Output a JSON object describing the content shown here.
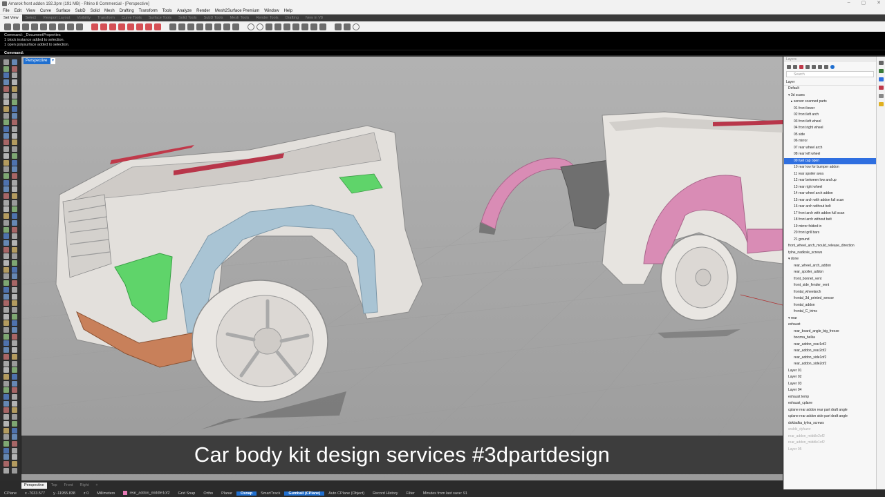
{
  "window": {
    "title": "Amarok front addon 192.3pm (191 MB) - Rhino 8 Commercial - [Perspective]"
  },
  "menu": {
    "items": [
      "File",
      "Edit",
      "View",
      "Curve",
      "Surface",
      "SubD",
      "Solid",
      "Mesh",
      "Drafting",
      "Transform",
      "Tools",
      "Analyze",
      "Render",
      "Mesh2Surface Premium",
      "Window",
      "Help"
    ]
  },
  "toolbar_tabs": {
    "items": [
      "Set View",
      "Select",
      "Viewport Layout",
      "Visibility",
      "Transform",
      "Curve Tools",
      "Surface Tools",
      "Solid Tools",
      "SubD Tools",
      "Mesh Tools",
      "Render Tools",
      "Drafting",
      "New in V8"
    ],
    "active": "Set View"
  },
  "command": {
    "history": [
      "Command: _DocumentProperties",
      "1 block instance added to selection.",
      "1 open polysurface added to selection."
    ],
    "prompt": "Command:"
  },
  "viewport": {
    "label": "Perspective",
    "caret": "▾",
    "caption": "Car body kit design services #3dpartdesign"
  },
  "view_tabs": {
    "items": [
      "Perspective",
      "Top",
      "Front",
      "Right",
      "+"
    ],
    "active": "Perspective"
  },
  "status": {
    "cplane": "CPlane",
    "x": "x -7033.577",
    "y": "y -11955.838",
    "z": "z 0",
    "units": "Millimeters",
    "layer": "rear_addon_middle1of2",
    "grid_snap": "Grid Snap",
    "ortho": "Ortho",
    "planar": "Planar",
    "osnap": "Osnap",
    "smarttrack": "SmartTrack",
    "gumball": "Gumball (CPlane)",
    "auto_cplane": "Auto CPlane (Object)",
    "record_history": "Record History",
    "filter": "Filter",
    "minutes": "Minutes from last save: 91",
    "layer_color": "#e77ab5"
  },
  "layers_panel": {
    "panel_title": "Layers",
    "search_placeholder": "Search",
    "column_header": "Layer",
    "rows": [
      "Default",
      "▾ 3d scans",
      "▸ sensor scanned parts",
      "01 front lower",
      "02 front left arch",
      "03 front left wheel",
      "04 front right wheel",
      "05 side",
      "06 mirror",
      "07 rear wheel arch",
      "08 rear left wheel",
      "09 fuel cap open",
      "10 rear low for bumper addon",
      "11 rear spoiler area",
      "12 rear between low and up",
      "13 rear right wheel",
      "14 rear wheel arch addon",
      "15 rear arch with addon full scan",
      "16 rear arch without belt",
      "17 front arch with addon full scan",
      "18 front arch without belt",
      "19 mirror folded in",
      "20 front grill bars",
      "21 ground",
      "front_wheel_arch_mould_release_direction",
      "tylne_nadkole_screws",
      "▾ done",
      "rear_wheel_arch_addon",
      "rear_spoiler_addon",
      "front_bonnet_vent",
      "front_side_fender_vent",
      "frontal_wheelarch",
      "frontal_3d_printed_sensor",
      "frontal_addon",
      "frontal_C_trims",
      "▾ rear",
      "exhaust",
      "rear_board_angle_big_freeze",
      "boczna_belka",
      "rear_addon_rear1of2",
      "rear_addon_rear2of2",
      "rear_addon_side1of2",
      "rear_addon_side2of2",
      "Layer 01",
      "Layer 02",
      "Layer 03",
      "Layer 04",
      "exhaust temp",
      "exhaust_cplane",
      "cplane rear addon rear part draft angle",
      "cplane rear addon side part draft angle",
      "dokladka_tylna_screws",
      "srubki_dyfuzor",
      "rear_addon_middle2of2",
      "rear_addon_middle1of2",
      "Layer 05"
    ],
    "selected_index": 11
  },
  "colors": {
    "accent": "#1f6fd0",
    "selection": "#2f6fe0",
    "fender_blue": "#a9c4d4",
    "vent_green": "#5fd46a",
    "splitter_orange": "#c8805a",
    "arch_pink": "#d98cb5"
  }
}
